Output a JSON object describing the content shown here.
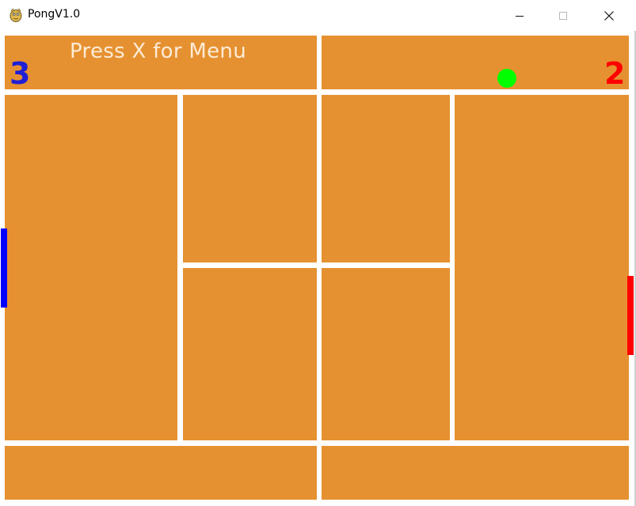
{
  "window": {
    "title": "PongV1.0"
  },
  "hud": {
    "menu_hint": "Press X for Menu",
    "left_score": "3",
    "right_score": "2"
  },
  "colors": {
    "court": "#e69131",
    "lines": "#ffffff",
    "left_player": "#0000ff",
    "right_player": "#ff0000",
    "ball": "#00ff00"
  },
  "icons": {
    "app": "pygame-snake-icon",
    "minimize": "minimize-icon",
    "maximize": "maximize-icon",
    "close": "close-icon"
  }
}
